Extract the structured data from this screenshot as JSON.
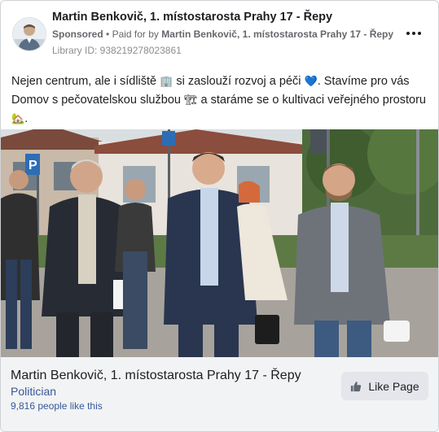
{
  "post": {
    "page_name": "Martin Benkovič, 1. místostarosta Prahy 17 - Řepy",
    "sponsored_label": "Sponsored",
    "separator": "•",
    "paid_for_prefix": "Paid for by",
    "paid_for_name": "Martin Benkovič, 1. místostarosta Prahy 17 - Řepy",
    "library_id": "Library ID: 938219278023861",
    "text": {
      "part1": "Nejen centrum, ale i sídliště ",
      "emoji_building": "🏢",
      "part2": " si zaslouží rozvoj a péči ",
      "emoji_heart": "💙",
      "part3": ". Stavíme pro vás Domov s pečovatelskou službou ",
      "emoji_crane": "🏗",
      "part4": " a staráme se o kultivaci veřejného prostoru ",
      "emoji_house": "🏡",
      "part5": "."
    }
  },
  "footer": {
    "page_name": "Martin Benkovič, 1. místostarosta Prahy 17 - Řepy",
    "category": "Politician",
    "likes": "9,816 people like this",
    "like_button_label": "Like Page"
  },
  "icons": {
    "more": "more-horizontal-icon",
    "like": "thumbs-up-icon"
  },
  "colors": {
    "link_blue": "#385898",
    "footer_bg": "#f2f3f5",
    "button_bg": "#e4e6eb",
    "heart_blue": "#4a90d9"
  }
}
